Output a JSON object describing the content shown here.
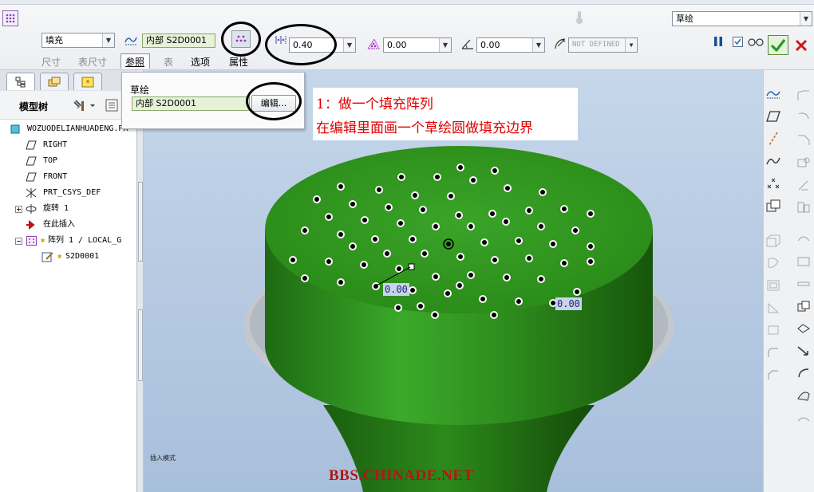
{
  "dashboard": {
    "pattern_type": "填充",
    "sketch_ref": "内部 S2D0001",
    "spacing": "0.40",
    "border": "0.00",
    "angle": "0.00",
    "radius": "NOT DEFINED",
    "filter": "草绘",
    "tabs": [
      "尺寸",
      "表尺寸",
      "参照",
      "表",
      "选项",
      "属性"
    ]
  },
  "ref_popup": {
    "title": "草绘",
    "field": "内部 S2D0001",
    "edit_button": "编辑..."
  },
  "model_tree": {
    "title": "模型树",
    "items": [
      {
        "label": "WOZUODELIANHUADENG.PR",
        "icon": "part-icon"
      },
      {
        "label": "RIGHT",
        "icon": "datum-plane-icon"
      },
      {
        "label": "TOP",
        "icon": "datum-plane-icon"
      },
      {
        "label": "FRONT",
        "icon": "datum-plane-icon"
      },
      {
        "label": "PRT_CSYS_DEF",
        "icon": "csys-icon"
      },
      {
        "label": "旋转 1",
        "icon": "revolve-icon"
      },
      {
        "label": "在此插入",
        "icon": "insert-arrow-icon"
      },
      {
        "label": "阵列 1 / LOCAL_G",
        "icon": "pattern-icon"
      },
      {
        "label": "S2D0001",
        "icon": "sketch-icon"
      }
    ]
  },
  "annotation": {
    "line1": "1：做一个填充阵列",
    "line2": "在编辑里面画一个草绘圆做填充边界"
  },
  "viewport": {
    "status": "插入模式",
    "dim1": "0.00",
    "dim2": "0.00",
    "watermark": "BBS.CHINADE.NET"
  },
  "colors": {
    "model_green": "#2f8f1e",
    "annotation_red": "#e00000"
  }
}
